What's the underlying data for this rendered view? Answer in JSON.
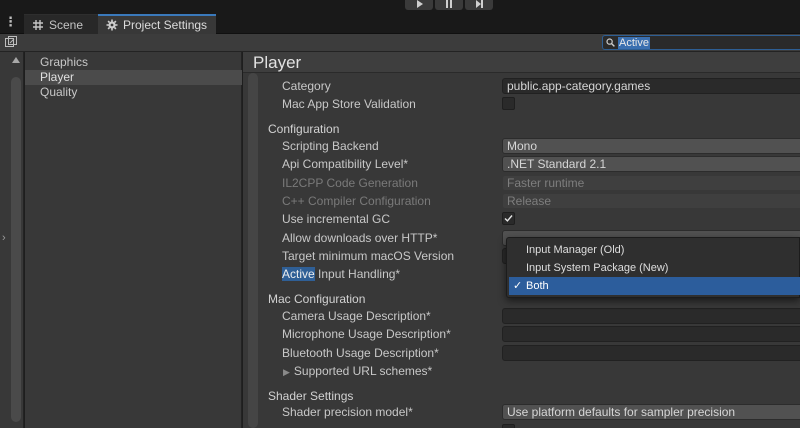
{
  "tabs": [
    {
      "label": "Scene",
      "icon": "grid-icon"
    },
    {
      "label": "Project Settings",
      "icon": "gear-icon"
    }
  ],
  "search": {
    "value": "Active"
  },
  "categories": [
    {
      "label": "Graphics"
    },
    {
      "label": "Player",
      "selected": true
    },
    {
      "label": "Quality"
    }
  ],
  "page": {
    "title": "Player"
  },
  "rows": {
    "category": {
      "label": "Category",
      "value": "public.app-category.games"
    },
    "mac_app_store_validation": {
      "label": "Mac App Store Validation",
      "checked": false
    },
    "configuration_header": "Configuration",
    "scripting_backend": {
      "label": "Scripting Backend",
      "value": "Mono"
    },
    "api_compat": {
      "label": "Api Compatibility Level*",
      "value": ".NET Standard 2.1"
    },
    "il2cpp_codegen": {
      "label": "IL2CPP Code Generation",
      "value": "Faster runtime"
    },
    "cpp_compiler": {
      "label": "C++ Compiler Configuration",
      "value": "Release"
    },
    "incremental_gc": {
      "label": "Use incremental GC",
      "checked": true
    },
    "allow_http": {
      "label": "Allow downloads over HTTP*"
    },
    "target_macos": {
      "label": "Target minimum macOS Version"
    },
    "active_input": {
      "label_highlight": "Active",
      "label_rest": " Input Handling*"
    },
    "mac_config_header": "Mac Configuration",
    "camera_usage": {
      "label": "Camera Usage Description*",
      "value": ""
    },
    "microphone_usage": {
      "label": "Microphone Usage Description*",
      "value": ""
    },
    "bluetooth_usage": {
      "label": "Bluetooth Usage Description*",
      "value": ""
    },
    "supported_url": {
      "label": "Supported URL schemes*"
    },
    "shader_header": "Shader Settings",
    "shader_precision": {
      "label": "Shader precision model*",
      "value": "Use platform defaults for sampler precision"
    }
  },
  "dropdown": {
    "options": [
      {
        "label": "Input Manager (Old)"
      },
      {
        "label": "Input System Package (New)"
      },
      {
        "label": "Both",
        "selected": true
      }
    ]
  },
  "colors": {
    "accent": "#2c5d9c",
    "highlight": "#2f5f96",
    "panel": "#383838"
  }
}
